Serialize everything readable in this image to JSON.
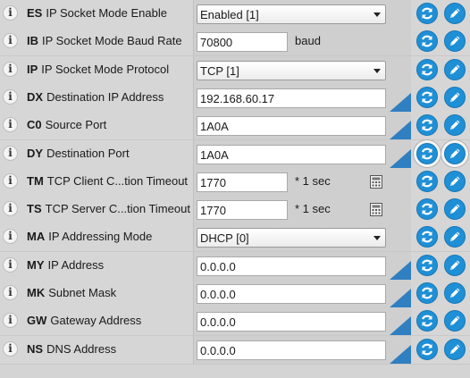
{
  "rows": [
    {
      "code": "ES",
      "label": "IP Socket Mode Enable",
      "type": "select",
      "value": "Enabled [1]"
    },
    {
      "code": "IB",
      "label": "IP Socket Mode Baud Rate",
      "type": "text-unit",
      "value": "70800",
      "unit": "baud"
    },
    {
      "code": "IP",
      "label": "IP Socket Mode Protocol",
      "type": "select",
      "value": "TCP [1]"
    },
    {
      "code": "DX",
      "label": "Destination IP Address",
      "type": "text",
      "value": "192.168.60.17"
    },
    {
      "code": "C0",
      "label": "Source Port",
      "type": "text",
      "value": "1A0A"
    },
    {
      "code": "DY",
      "label": "Destination Port",
      "type": "text",
      "value": "1A0A",
      "highlight": true
    },
    {
      "code": "TM",
      "label": "TCP Client C...tion Timeout",
      "type": "text-unit-calc",
      "value": "1770",
      "unit": "* 1 sec"
    },
    {
      "code": "TS",
      "label": "TCP Server C...tion Timeout",
      "type": "text-unit-calc",
      "value": "1770",
      "unit": "* 1 sec"
    },
    {
      "code": "MA",
      "label": "IP Addressing Mode",
      "type": "select",
      "value": "DHCP [0]"
    },
    {
      "code": "MY",
      "label": "IP Address",
      "type": "text",
      "value": "0.0.0.0"
    },
    {
      "code": "MK",
      "label": "Subnet Mask",
      "type": "text",
      "value": "0.0.0.0"
    },
    {
      "code": "GW",
      "label": "Gateway Address",
      "type": "text",
      "value": "0.0.0.0"
    },
    {
      "code": "NS",
      "label": "DNS Address",
      "type": "text",
      "value": "0.0.0.0"
    }
  ],
  "icons": {
    "info": "info-icon",
    "read": "refresh-icon",
    "write": "pencil-icon",
    "calc": "calculator-icon",
    "info_glyph": "i"
  },
  "colors": {
    "accent": "#1f8fd6",
    "corner": "#2f7fc1"
  }
}
